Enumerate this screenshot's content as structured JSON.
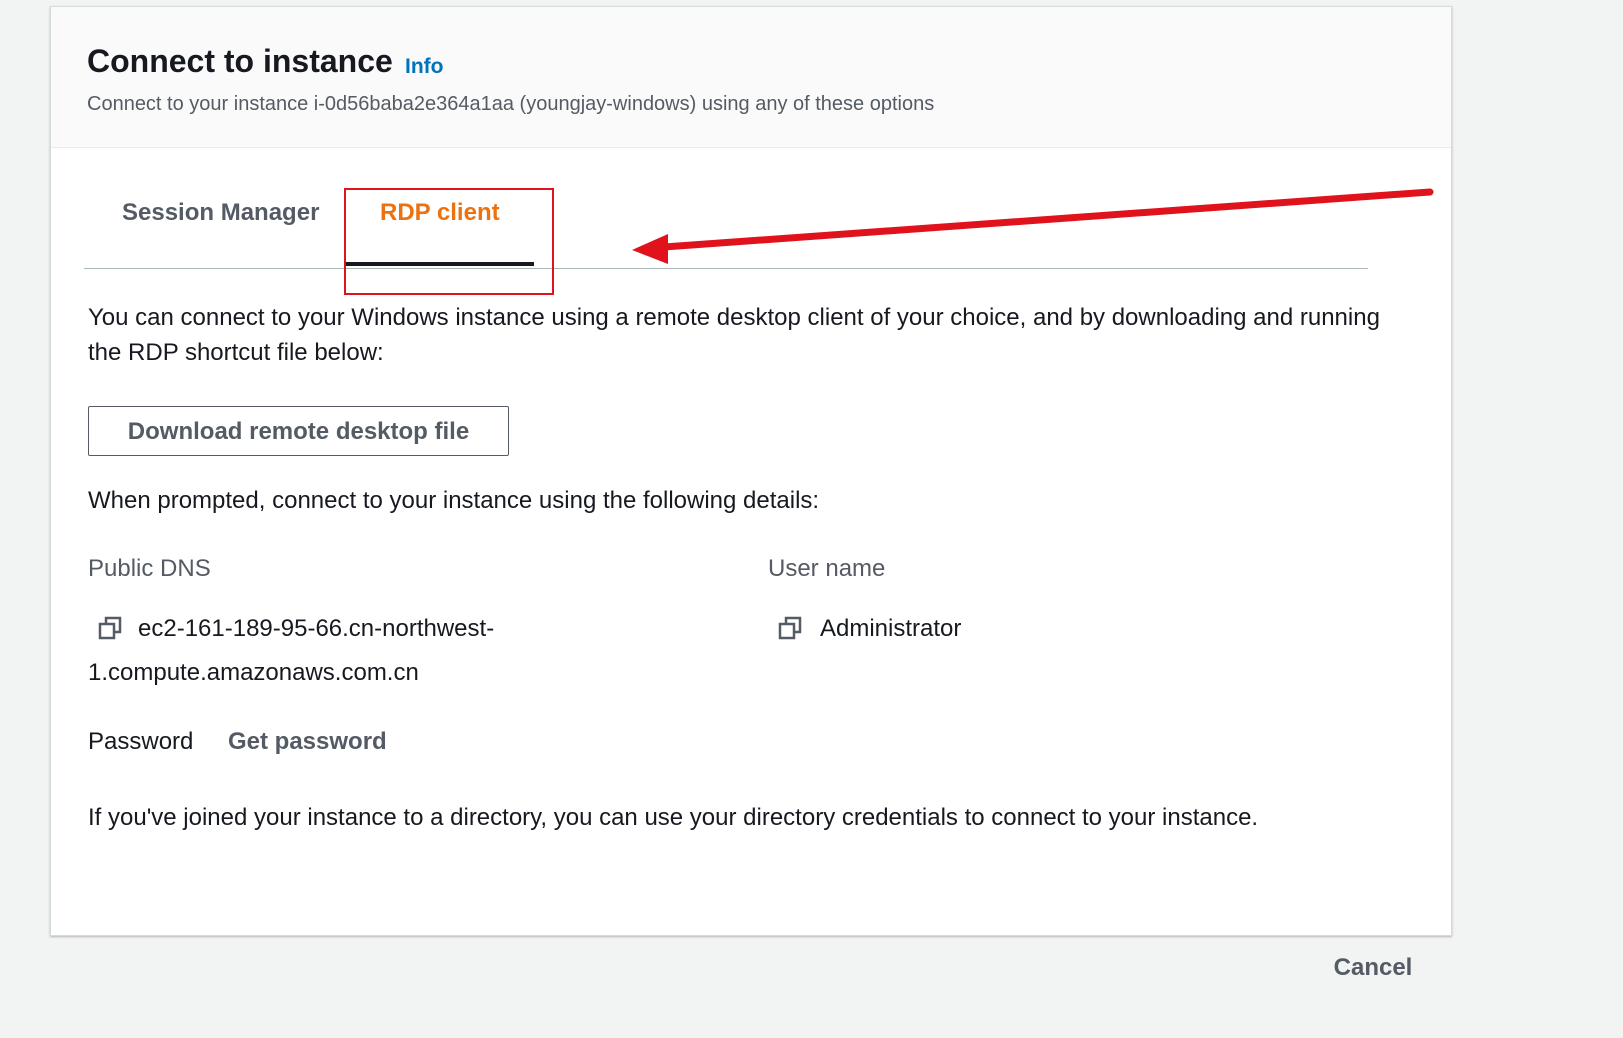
{
  "header": {
    "title": "Connect to instance",
    "info_label": "Info",
    "subtitle": "Connect to your instance i-0d56baba2e364a1aa (youngjay-windows) using any of these options"
  },
  "tabs": [
    {
      "label": "Session Manager",
      "active": false
    },
    {
      "label": "RDP client",
      "active": true
    }
  ],
  "rdp": {
    "intro": "You can connect to your Windows instance using a remote desktop client of your choice, and by downloading and running the RDP shortcut file below:",
    "download_button": "Download remote desktop file",
    "prompted_text": "When prompted, connect to your instance using the following details:",
    "public_dns_label": "Public DNS",
    "public_dns_value": "ec2-161-189-95-66.cn-northwest-1.compute.amazonaws.com.cn",
    "user_name_label": "User name",
    "user_name_value": "Administrator",
    "password_label": "Password",
    "get_password_label": "Get password",
    "directory_note": "If you've joined your instance to a directory, you can use your directory credentials to connect to your instance."
  },
  "footer": {
    "cancel_label": "Cancel"
  },
  "icons": {
    "copy": "copy-icon"
  },
  "colors": {
    "active_tab": "#ec7211",
    "link": "#0073bb",
    "annotation": "#e0131c"
  }
}
